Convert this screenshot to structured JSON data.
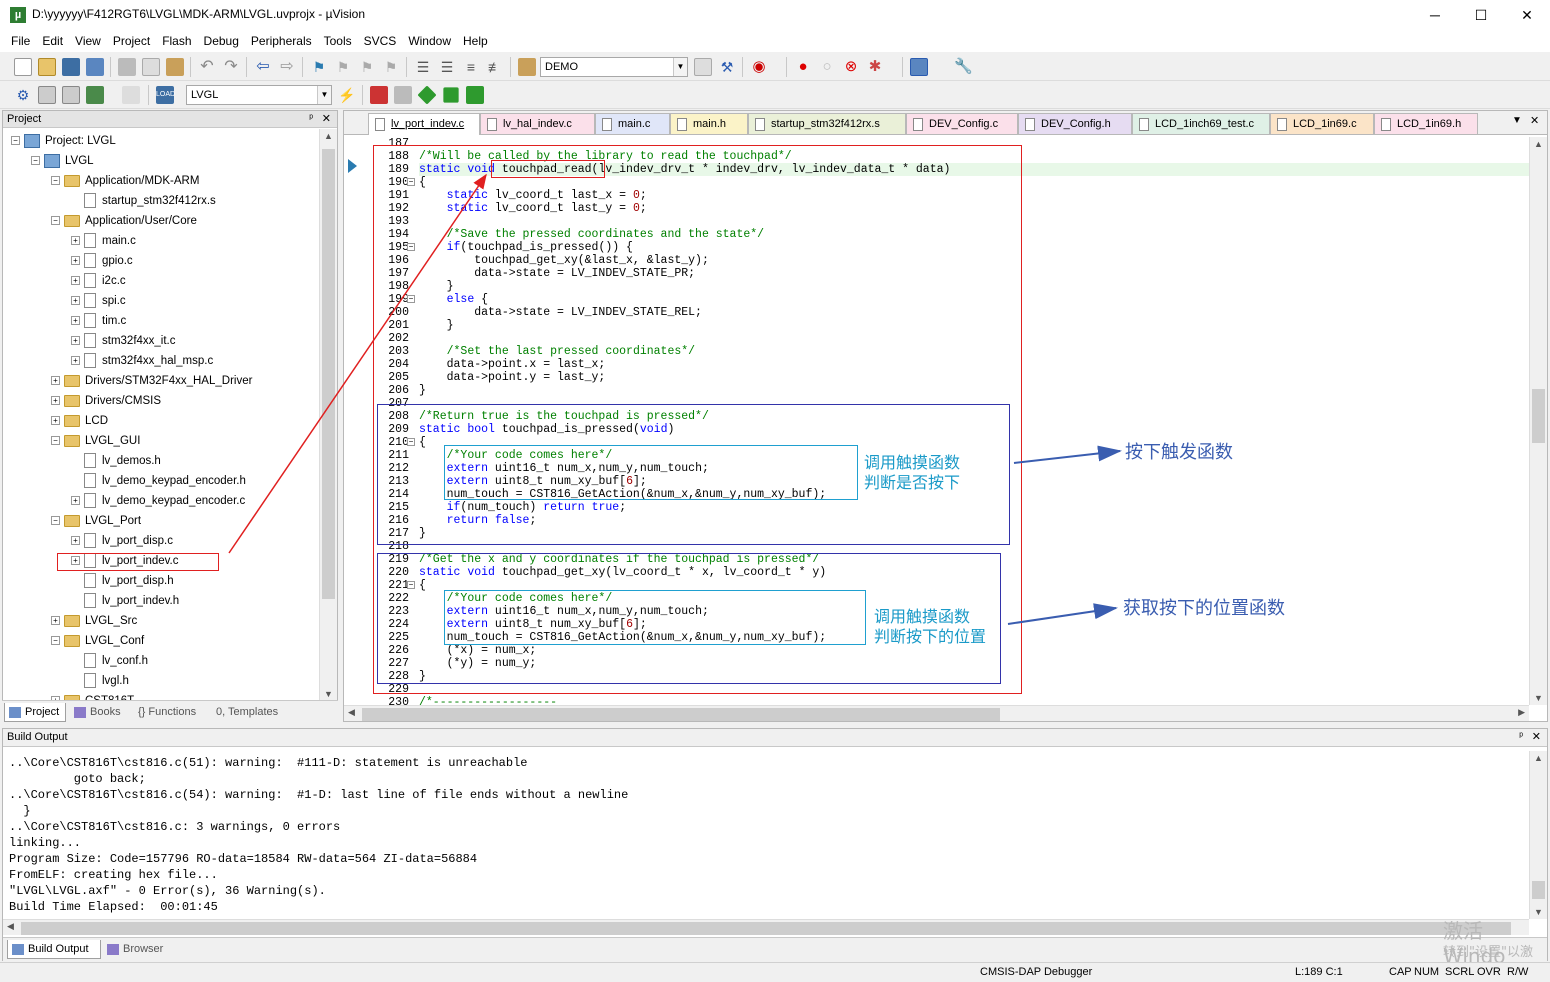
{
  "window": {
    "title": "D:\\yyyyyy\\F412RGT6\\LVGL\\MDK-ARM\\LVGL.uvprojx - µVision",
    "minimize": "─",
    "maximize": "☐",
    "close": "✕"
  },
  "menu": [
    "File",
    "Edit",
    "View",
    "Project",
    "Flash",
    "Debug",
    "Peripherals",
    "Tools",
    "SVCS",
    "Window",
    "Help"
  ],
  "toolbar": {
    "target_combo": "DEMO",
    "build_target_combo": "LVGL"
  },
  "project_panel": {
    "header": "Project",
    "pin": "ᵖ",
    "close": "✕",
    "tree": [
      {
        "label": "Project: LVGL",
        "level": 0,
        "type": "proj",
        "exp": "−"
      },
      {
        "label": "LVGL",
        "level": 1,
        "type": "target",
        "exp": "−"
      },
      {
        "label": "Application/MDK-ARM",
        "level": 2,
        "type": "folder",
        "exp": "−"
      },
      {
        "label": "startup_stm32f412rx.s",
        "level": 3,
        "type": "file",
        "exp": ""
      },
      {
        "label": "Application/User/Core",
        "level": 2,
        "type": "folder",
        "exp": "−"
      },
      {
        "label": "main.c",
        "level": 3,
        "type": "file",
        "exp": "+"
      },
      {
        "label": "gpio.c",
        "level": 3,
        "type": "file",
        "exp": "+"
      },
      {
        "label": "i2c.c",
        "level": 3,
        "type": "file",
        "exp": "+"
      },
      {
        "label": "spi.c",
        "level": 3,
        "type": "file",
        "exp": "+"
      },
      {
        "label": "tim.c",
        "level": 3,
        "type": "file",
        "exp": "+"
      },
      {
        "label": "stm32f4xx_it.c",
        "level": 3,
        "type": "file",
        "exp": "+"
      },
      {
        "label": "stm32f4xx_hal_msp.c",
        "level": 3,
        "type": "file",
        "exp": "+"
      },
      {
        "label": "Drivers/STM32F4xx_HAL_Driver",
        "level": 2,
        "type": "folder",
        "exp": "+"
      },
      {
        "label": "Drivers/CMSIS",
        "level": 2,
        "type": "folder",
        "exp": "+"
      },
      {
        "label": "LCD",
        "level": 2,
        "type": "folder",
        "exp": "+"
      },
      {
        "label": "LVGL_GUI",
        "level": 2,
        "type": "folder",
        "exp": "−"
      },
      {
        "label": "lv_demos.h",
        "level": 3,
        "type": "file",
        "exp": ""
      },
      {
        "label": "lv_demo_keypad_encoder.h",
        "level": 3,
        "type": "file",
        "exp": ""
      },
      {
        "label": "lv_demo_keypad_encoder.c",
        "level": 3,
        "type": "file",
        "exp": "+"
      },
      {
        "label": "LVGL_Port",
        "level": 2,
        "type": "folder",
        "exp": "−"
      },
      {
        "label": "lv_port_disp.c",
        "level": 3,
        "type": "file",
        "exp": "+"
      },
      {
        "label": "lv_port_indev.c",
        "level": 3,
        "type": "file",
        "exp": "+"
      },
      {
        "label": "lv_port_disp.h",
        "level": 3,
        "type": "file",
        "exp": ""
      },
      {
        "label": "lv_port_indev.h",
        "level": 3,
        "type": "file",
        "exp": ""
      },
      {
        "label": "LVGL_Src",
        "level": 2,
        "type": "folder",
        "exp": "+"
      },
      {
        "label": "LVGL_Conf",
        "level": 2,
        "type": "folder",
        "exp": "−"
      },
      {
        "label": "lv_conf.h",
        "level": 3,
        "type": "file",
        "exp": ""
      },
      {
        "label": "lvgl.h",
        "level": 3,
        "type": "file",
        "exp": ""
      },
      {
        "label": "CST816T",
        "level": 2,
        "type": "folder",
        "exp": "+"
      }
    ],
    "tabs": [
      "Project",
      "Books",
      "{} Functions",
      "0, Templates"
    ]
  },
  "editor": {
    "tabs": [
      "lv_port_indev.c",
      "lv_hal_indev.c",
      "main.c",
      "main.h",
      "startup_stm32f412rx.s",
      "DEV_Config.c",
      "DEV_Config.h",
      "LCD_1inch69_test.c",
      "LCD_1in69.c",
      "LCD_1in69.h"
    ],
    "tab_menu": "▼",
    "tab_close": "✕",
    "line_numbers": [
      "187",
      "188",
      "189",
      "190",
      "191",
      "192",
      "193",
      "194",
      "195",
      "196",
      "197",
      "198",
      "199",
      "200",
      "201",
      "202",
      "203",
      "204",
      "205",
      "206",
      "207",
      "208",
      "209",
      "210",
      "211",
      "212",
      "213",
      "214",
      "215",
      "216",
      "217",
      "218",
      "219",
      "220",
      "221",
      "222",
      "223",
      "224",
      "225",
      "226",
      "227",
      "228",
      "229",
      "230"
    ],
    "lines": [
      "",
      "/*Will be called by the library to read the touchpad*/",
      "static void touchpad_read(lv_indev_drv_t * indev_drv, lv_indev_data_t * data)",
      "{",
      "    static lv_coord_t last_x = 0;",
      "    static lv_coord_t last_y = 0;",
      "",
      "    /*Save the pressed coordinates and the state*/",
      "    if(touchpad_is_pressed()) {",
      "        touchpad_get_xy(&last_x, &last_y);",
      "        data->state = LV_INDEV_STATE_PR;",
      "    }",
      "    else {",
      "        data->state = LV_INDEV_STATE_REL;",
      "    }",
      "",
      "    /*Set the last pressed coordinates*/",
      "    data->point.x = last_x;",
      "    data->point.y = last_y;",
      "}",
      "",
      "/*Return true is the touchpad is pressed*/",
      "static bool touchpad_is_pressed(void)",
      "{",
      "    /*Your code comes here*/",
      "    extern uint16_t num_x,num_y,num_touch;",
      "    extern uint8_t num_xy_buf[6];",
      "    num_touch = CST816_GetAction(&num_x,&num_y,num_xy_buf);",
      "    if(num_touch) return true;",
      "    return false;",
      "}",
      "",
      "/*Get the x and y coordinates if the touchpad is pressed*/",
      "static void touchpad_get_xy(lv_coord_t * x, lv_coord_t * y)",
      "{",
      "    /*Your code comes here*/",
      "    extern uint16_t num_x,num_y,num_touch;",
      "    extern uint8_t num_xy_buf[6];",
      "    num_touch = CST816_GetAction(&num_x,&num_y,num_xy_buf);",
      "    (*x) = num_x;",
      "    (*y) = num_y;",
      "}",
      "",
      "/*------------------"
    ]
  },
  "annotations": {
    "note1": "调用触摸函数\n判断是否按下",
    "note2": "调用触摸函数\n判断按下的位置",
    "label1": "按下触发函数",
    "label2": "获取按下的位置函数"
  },
  "build": {
    "header": "Build Output",
    "pin": "ᵖ",
    "close": "✕",
    "output": "..\\Core\\CST816T\\cst816.c(51): warning:  #111-D: statement is unreachable\n         goto back;\n..\\Core\\CST816T\\cst816.c(54): warning:  #1-D: last line of file ends without a newline\n  }\n..\\Core\\CST816T\\cst816.c: 3 warnings, 0 errors\nlinking...\nProgram Size: Code=157796 RO-data=18584 RW-data=564 ZI-data=56884\nFromELF: creating hex file...\n\"LVGL\\LVGL.axf\" - 0 Error(s), 36 Warning(s).\nBuild Time Elapsed:  00:01:45",
    "tabs": [
      "Build Output",
      "Browser"
    ]
  },
  "status": {
    "debugger": "CMSIS-DAP Debugger",
    "position": "L:189 C:1",
    "cap": "CAP",
    "num": "NUM",
    "scrl": "SCRL",
    "ovr": "OVR",
    "rw": "R/W"
  },
  "watermark": {
    "line1": "激活 Windo",
    "line2": "转到\"设置\"以激"
  },
  "colors": {
    "red_box": "#e02020",
    "blue_box": "#3333aa",
    "cyan_box": "#1fa0d0",
    "arrow_blue": "#3a5db0",
    "cyan_text": "#1a9ac8"
  }
}
